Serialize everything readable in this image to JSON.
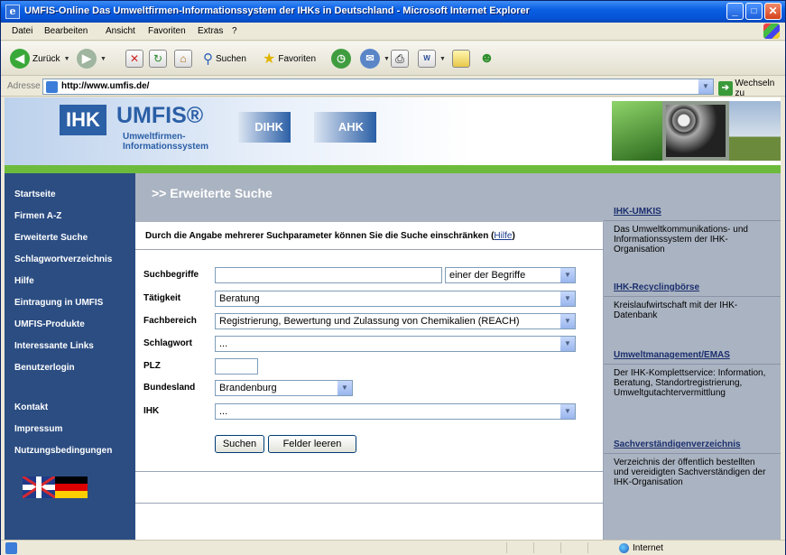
{
  "window": {
    "title": "UMFIS-Online Das Umweltfirmen-Informationssystem der IHKs in Deutschland - Microsoft Internet Explorer",
    "app_icon": "e",
    "controls": {
      "minimize": "_",
      "maximize": "□",
      "close": "✕"
    }
  },
  "menubar": [
    "Datei",
    "Bearbeiten",
    "Ansicht",
    "Favoriten",
    "Extras",
    "?"
  ],
  "toolbar": {
    "back": "Zurück",
    "search": "Suchen",
    "favorites": "Favoriten"
  },
  "addressbar": {
    "label": "Adresse",
    "url": "http://www.umfis.de/",
    "go": "Wechseln zu"
  },
  "banner": {
    "ihk": "IHK",
    "umfis": "UMFIS®",
    "subtitle_line1": "Umweltfirmen-",
    "subtitle_line2": "Informationssystem",
    "dihk": "DIHK",
    "ahk": "AHK"
  },
  "nav": {
    "items": [
      "Startseite",
      "Firmen A-Z",
      "Erweiterte Suche",
      "Schlagwortverzeichnis",
      "Hilfe",
      "Eintragung in UMFIS",
      "UMFIS-Produkte",
      "Interessante Links",
      "Benutzerlogin",
      "Kontakt",
      "Impressum",
      "Nutzungsbedingungen"
    ]
  },
  "main": {
    "heading": ">> Erweiterte Suche",
    "hint": "Durch die Angabe mehrerer Suchparameter können Sie die Suche einschränken (",
    "hint_link": "Hilfe",
    "hint_end": ")",
    "form": {
      "suchbegriffe_label": "Suchbegriffe",
      "suchbegriffe_value": "",
      "suchbegriffe_mode": "einer der Begriffe",
      "taetigkeit_label": "Tätigkeit",
      "taetigkeit_value": "Beratung",
      "fachbereich_label": "Fachbereich",
      "fachbereich_value": "Registrierung, Bewertung und Zulassung von Chemikalien (REACH)",
      "schlagwort_label": "Schlagwort",
      "schlagwort_value": "...",
      "plz_label": "PLZ",
      "plz_value": "",
      "bundesland_label": "Bundesland",
      "bundesland_value": "Brandenburg",
      "ihk_label": "IHK",
      "ihk_value": "...",
      "search_button": "Suchen",
      "clear_button": "Felder leeren"
    }
  },
  "right": {
    "sections": [
      {
        "link": "IHK-UMKIS",
        "text": "Das Umweltkommunikations- und Informationssystem der IHK-Organisation"
      },
      {
        "link": "IHK-Recyclingbörse",
        "text": "Kreislaufwirtschaft mit der IHK-Datenbank"
      },
      {
        "link": "Umweltmanagement/EMAS",
        "text": "Der IHK-Komplettservice: Information, Beratung, Standortregistrierung, Umweltgutachtervermittlung"
      },
      {
        "link": "Sachverständigenverzeichnis",
        "text": "Verzeichnis der öffentlich bestellten und vereidigten Sachverständigen der IHK-Organisation"
      }
    ]
  },
  "statusbar": {
    "zone": "Internet"
  },
  "colors": {
    "nav_bg": "#2b4d82",
    "green_strip": "#6dbb3c",
    "header_bg": "#aab3c1",
    "brand": "#2b5fa6"
  }
}
